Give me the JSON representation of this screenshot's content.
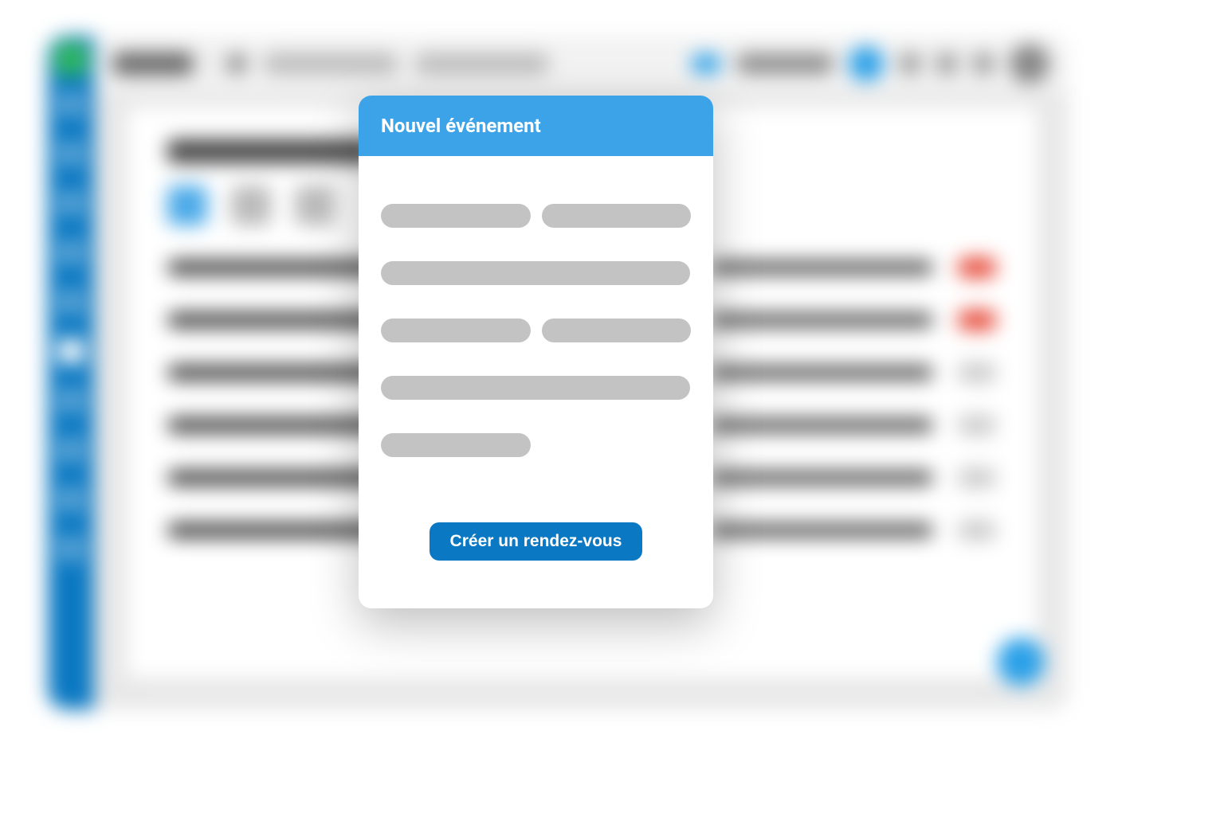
{
  "modal": {
    "title": "Nouvel événement",
    "create_button_label": "Créer un rendez-vous"
  }
}
